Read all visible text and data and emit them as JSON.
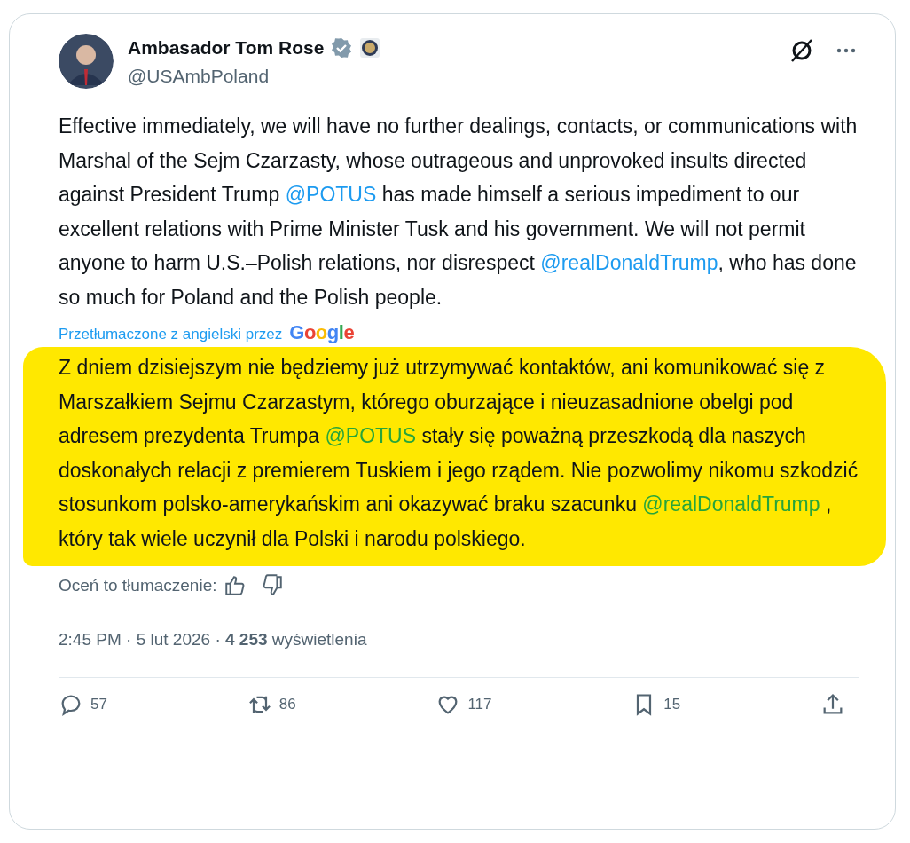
{
  "author": {
    "name": "Ambasador Tom Rose",
    "handle": "@USAmbPoland",
    "verified": true
  },
  "post": [
    {
      "kind": "text",
      "text": "Effective immediately, we will have no further dealings, contacts, or communications with Marshal of the Sejm Czarzasty, whose outrageous and unprovoked insults directed  against President Trump "
    },
    {
      "kind": "mention",
      "text": "@POTUS"
    },
    {
      "kind": "text",
      "text": " has made himself a serious impediment to our excellent relations with Prime Minister Tusk and his government. We will not permit anyone to harm U.S.–Polish relations, nor disrespect "
    },
    {
      "kind": "mention",
      "text": "@realDonaldTrump"
    },
    {
      "kind": "text",
      "text": ", who has done so much for Poland and the Polish people."
    }
  ],
  "translation_note": {
    "label": "Przetłumaczone z angielski przez",
    "provider": "Google"
  },
  "translation": {
    "highlighted": true,
    "segments": [
      {
        "kind": "text",
        "text": "Z dniem dzisiejszym nie będziemy już utrzymywać kontaktów, ani komunikować się z Marszałkiem Sejmu Czarzastym, którego oburzające i nieuzasadnione obelgi pod adresem prezydenta Trumpa "
      },
      {
        "kind": "mention",
        "text": "@POTUS"
      },
      {
        "kind": "text",
        "text": " stały się poważną przeszkodą dla naszych doskonałych relacji z premierem Tuskiem i jego rządem. Nie pozwolimy nikomu szkodzić stosunkom polsko-amerykańskim ani okazywać braku szacunku "
      },
      {
        "kind": "mention",
        "text": "@realDonaldTrump"
      },
      {
        "kind": "text",
        "text": " , który tak wiele uczynił dla Polski i narodu polskiego."
      }
    ]
  },
  "rate_translation": "Oceń to tłumaczenie:",
  "meta": "2:45 PM · 5 lut 2026 · **4 253** wyświetlenia",
  "actions": [
    {
      "kind": "reply",
      "count": "57"
    },
    {
      "kind": "repost",
      "count": "86"
    },
    {
      "kind": "like",
      "count": "117"
    },
    {
      "kind": "bookmark",
      "count": "15"
    },
    {
      "kind": "share"
    }
  ]
}
